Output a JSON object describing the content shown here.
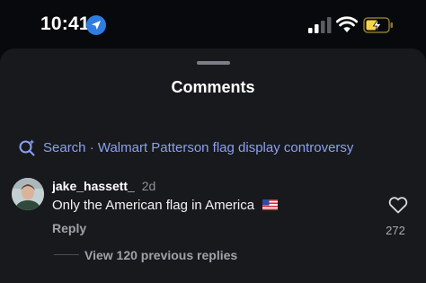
{
  "status_bar": {
    "time": "10:41",
    "icons": [
      "location-arrow-icon",
      "cellular-signal-icon",
      "wifi-icon",
      "battery-charging-icon"
    ]
  },
  "sheet": {
    "title": "Comments"
  },
  "search": {
    "label": "Search · Walmart Patterson flag display controversy",
    "color": "#8aa0f0"
  },
  "comment": {
    "username": "jake_hassett_",
    "time_ago": "2d",
    "text": "Only the American flag in America",
    "emoji": "us-flag",
    "reply_label": "Reply",
    "likes": "272"
  },
  "replies": {
    "view_label": "View 120 previous replies"
  },
  "colors": {
    "background": "#08090c",
    "sheet": "#18191d",
    "accent_link": "#8aa0f0",
    "battery": "#f5d547"
  }
}
